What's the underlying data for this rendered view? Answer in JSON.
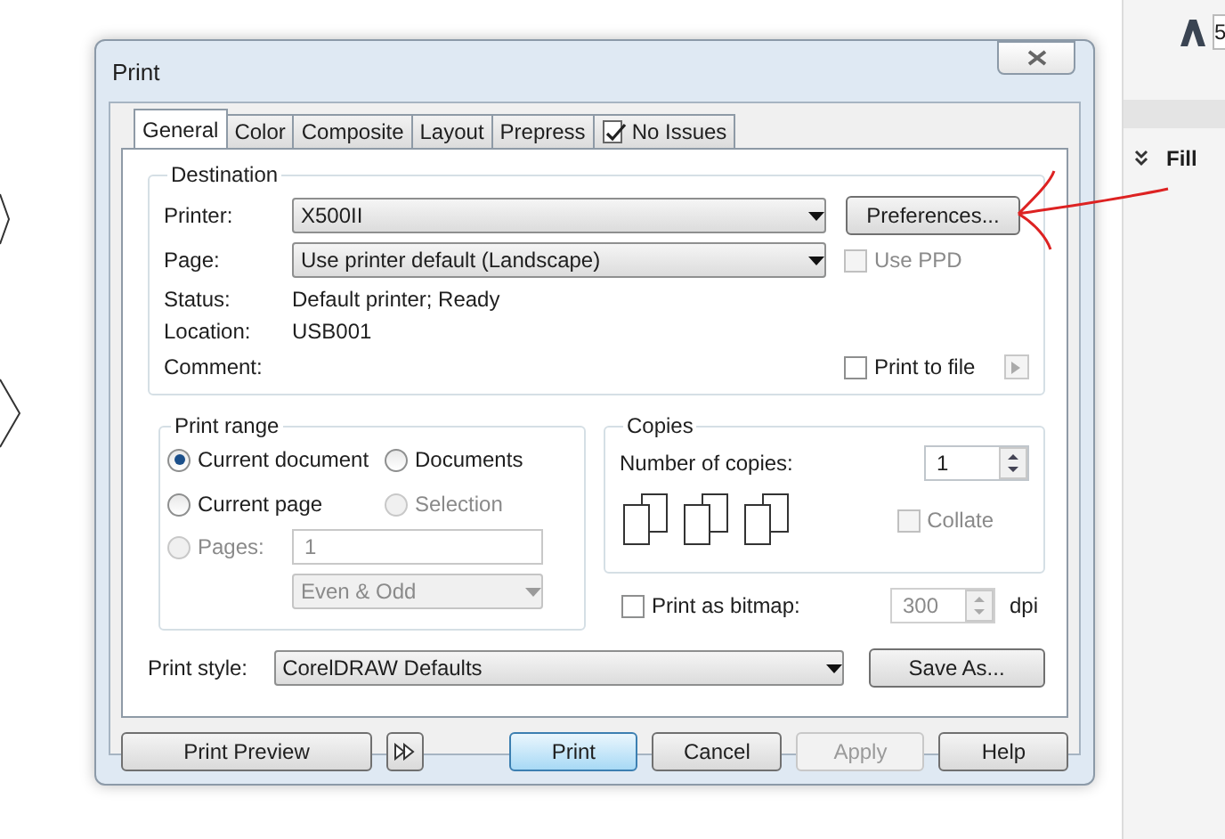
{
  "window": {
    "title": "Print"
  },
  "tabs": [
    {
      "label": "General",
      "selected": true
    },
    {
      "label": "Color",
      "selected": false
    },
    {
      "label": "Composite",
      "selected": false
    },
    {
      "label": "Layout",
      "selected": false
    },
    {
      "label": "Prepress",
      "selected": false
    },
    {
      "label": "No Issues",
      "selected": false,
      "kind": "issues"
    }
  ],
  "destination": {
    "title": "Destination",
    "printer_label": "Printer:",
    "printer": "X500II",
    "preferences_button": "Preferences...",
    "page_label": "Page:",
    "page": "Use printer default (Landscape)",
    "use_ppd": {
      "label": "Use PPD",
      "checked": false,
      "disabled": true
    },
    "status_label": "Status:",
    "status": "Default printer; Ready",
    "location_label": "Location:",
    "location": "USB001",
    "comment_label": "Comment:",
    "print_to_file": {
      "label": "Print to file",
      "checked": false,
      "disabled": false
    }
  },
  "print_range": {
    "title": "Print range",
    "options": [
      {
        "label": "Current document",
        "selected": true,
        "disabled": false
      },
      {
        "label": "Documents",
        "selected": false,
        "disabled": false
      },
      {
        "label": "Current page",
        "selected": false,
        "disabled": false
      },
      {
        "label": "Selection",
        "selected": false,
        "disabled": true
      },
      {
        "label": "Pages:",
        "selected": false,
        "disabled": true
      }
    ],
    "pages_value": "1",
    "parity": "Even & Odd"
  },
  "copies": {
    "title": "Copies",
    "label": "Number of copies:",
    "value": "1",
    "collate": {
      "label": "Collate",
      "checked": false,
      "disabled": true
    }
  },
  "print_as_bitmap": {
    "label": "Print as bitmap:",
    "checked": false,
    "dpi": "300",
    "unit": "dpi"
  },
  "print_style": {
    "label": "Print style:",
    "value": "CorelDRAW Defaults",
    "save_button": "Save As..."
  },
  "buttons": [
    {
      "label": "Print Preview",
      "kind": "normal",
      "disabled": false
    },
    {
      "kind": "icon",
      "disabled": false
    },
    {
      "label": "Print",
      "kind": "default",
      "disabled": false
    },
    {
      "label": "Cancel",
      "kind": "normal",
      "disabled": false
    },
    {
      "label": "Apply",
      "kind": "normal",
      "disabled": true
    },
    {
      "label": "Help",
      "kind": "normal",
      "disabled": false
    }
  ],
  "side_panel": {
    "field_value": "5",
    "section": "Fill"
  }
}
